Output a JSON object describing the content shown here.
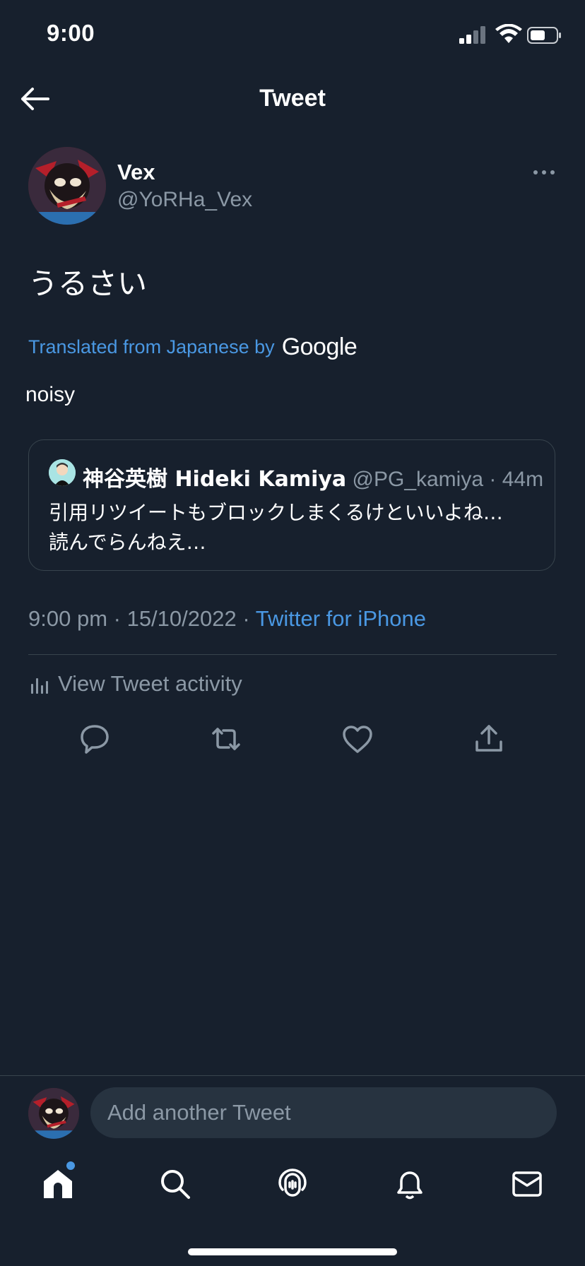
{
  "status_bar": {
    "time": "9:00"
  },
  "header": {
    "title": "Tweet"
  },
  "author": {
    "name": "Vex",
    "handle": "@YoRHa_Vex"
  },
  "tweet": {
    "text": "うるさい",
    "translated_label": "Translated from Japanese by",
    "translator": "Google",
    "translation": "noisy"
  },
  "quoted_tweet": {
    "name": "神谷英樹 Hideki Kamiya",
    "handle": "@PG_kamiya",
    "separator": "·",
    "time": "44m",
    "body_line1": "引用リツイートもブロックしまくるけといいよね…",
    "body_line2": "読んでらんねえ…"
  },
  "meta": {
    "time": "9:00 pm",
    "separator": " · ",
    "date": "15/10/2022",
    "source": "Twitter for iPhone"
  },
  "activity": {
    "label": "View Tweet activity"
  },
  "reply": {
    "placeholder": "Add another Tweet"
  },
  "colors": {
    "background": "#17202d",
    "accent": "#4a98e3",
    "muted": "#8b98a5",
    "border": "#38444d",
    "input_bg": "#273340"
  },
  "icons": {
    "back": "arrow-left-icon",
    "more": "more-horizontal-icon",
    "activity": "bar-chart-icon",
    "reply": "reply-icon",
    "retweet": "retweet-icon",
    "like": "heart-icon",
    "share": "share-icon",
    "nav": [
      "home-icon",
      "search-icon",
      "spaces-icon",
      "notifications-icon",
      "messages-icon"
    ]
  }
}
